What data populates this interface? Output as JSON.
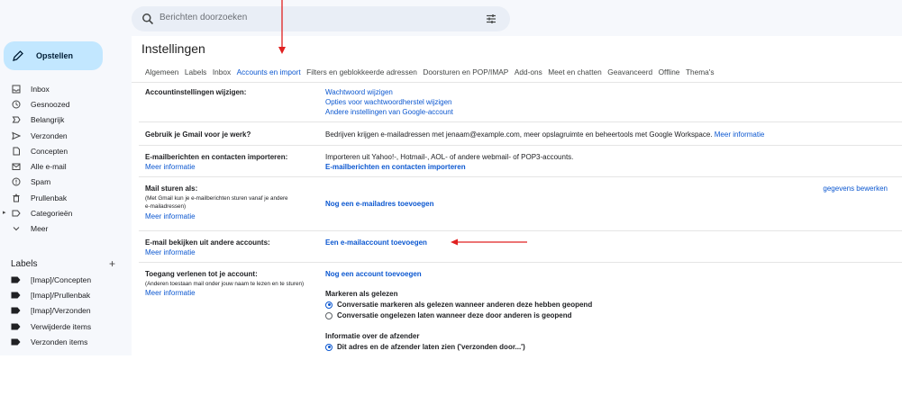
{
  "search": {
    "placeholder": "Berichten doorzoeken"
  },
  "compose": {
    "label": "Opstellen"
  },
  "nav": [
    {
      "label": "Inbox",
      "icon": "inbox-icon"
    },
    {
      "label": "Gesnoozed",
      "icon": "clock-icon"
    },
    {
      "label": "Belangrijk",
      "icon": "important-icon"
    },
    {
      "label": "Verzonden",
      "icon": "send-icon"
    },
    {
      "label": "Concepten",
      "icon": "draft-icon"
    },
    {
      "label": "Alle e-mail",
      "icon": "all-mail-icon"
    },
    {
      "label": "Spam",
      "icon": "spam-icon"
    },
    {
      "label": "Prullenbak",
      "icon": "trash-icon"
    },
    {
      "label": "Categorieën",
      "icon": "label-outline-icon"
    },
    {
      "label": "Meer",
      "icon": "chevron-down-icon"
    }
  ],
  "labels": {
    "heading": "Labels",
    "plus": "+",
    "items": [
      "[Imap]/Concepten",
      "[Imap]/Prullenbak",
      "[Imap]/Verzonden",
      "Verwijderde items",
      "Verzonden items"
    ]
  },
  "settings": {
    "title": "Instellingen",
    "tabs": [
      "Algemeen",
      "Labels",
      "Inbox",
      "Accounts en import",
      "Filters en geblokkeerde adressen",
      "Doorsturen en POP/IMAP",
      "Add-ons",
      "Meet en chatten",
      "Geavanceerd",
      "Offline",
      "Thema's"
    ],
    "active_tab": "Accounts en import",
    "rows": {
      "account": {
        "label": "Accountinstellingen wijzigen:",
        "links": [
          "Wachtwoord wijzigen",
          "Opties voor wachtwoordherstel wijzigen",
          "Andere instellingen van Google-account"
        ]
      },
      "work": {
        "label": "Gebruik je Gmail voor je werk?",
        "text": "Bedrijven krijgen e-mailadressen met jenaam@example.com, meer opslagruimte en beheertools met Google Workspace.",
        "link": "Meer informatie"
      },
      "import": {
        "label": "E-mailberichten en contacten importeren:",
        "more": "Meer informatie",
        "text": "Importeren uit Yahoo!-, Hotmail-, AOL- of andere webmail- of POP3-accounts.",
        "action": "E-mailberichten en contacten importeren"
      },
      "sendas": {
        "label": "Mail sturen als:",
        "sub1": "(Met Gmail kun je e-mailberichten sturen vanaf je andere",
        "sub2": "e-mailadressen)",
        "more": "Meer informatie",
        "action": "Nog een e-mailadres toevoegen",
        "edit": "gegevens bewerken"
      },
      "check": {
        "label": "E-mail bekijken uit andere accounts:",
        "more": "Meer informatie",
        "action": "Een e-mailaccount toevoegen"
      },
      "grant": {
        "label": "Toegang verlenen tot je account:",
        "sub": "(Anderen toestaan mail onder jouw naam te lezen en te sturen)",
        "more": "Meer informatie",
        "action": "Nog een account toevoegen",
        "mark_heading": "Markeren als gelezen",
        "mark_opt1": "Conversatie markeren als gelezen wanneer anderen deze hebben geopend",
        "mark_opt2": "Conversatie ongelezen laten wanneer deze door anderen is geopend",
        "sender_heading": "Informatie over de afzender",
        "sender_opt1": "Dit adres en de afzender laten zien ('verzonden door...')"
      }
    }
  },
  "colors": {
    "accent": "#0b57d0",
    "compose_bg": "#c2e7ff",
    "annotation": "#e02020"
  }
}
